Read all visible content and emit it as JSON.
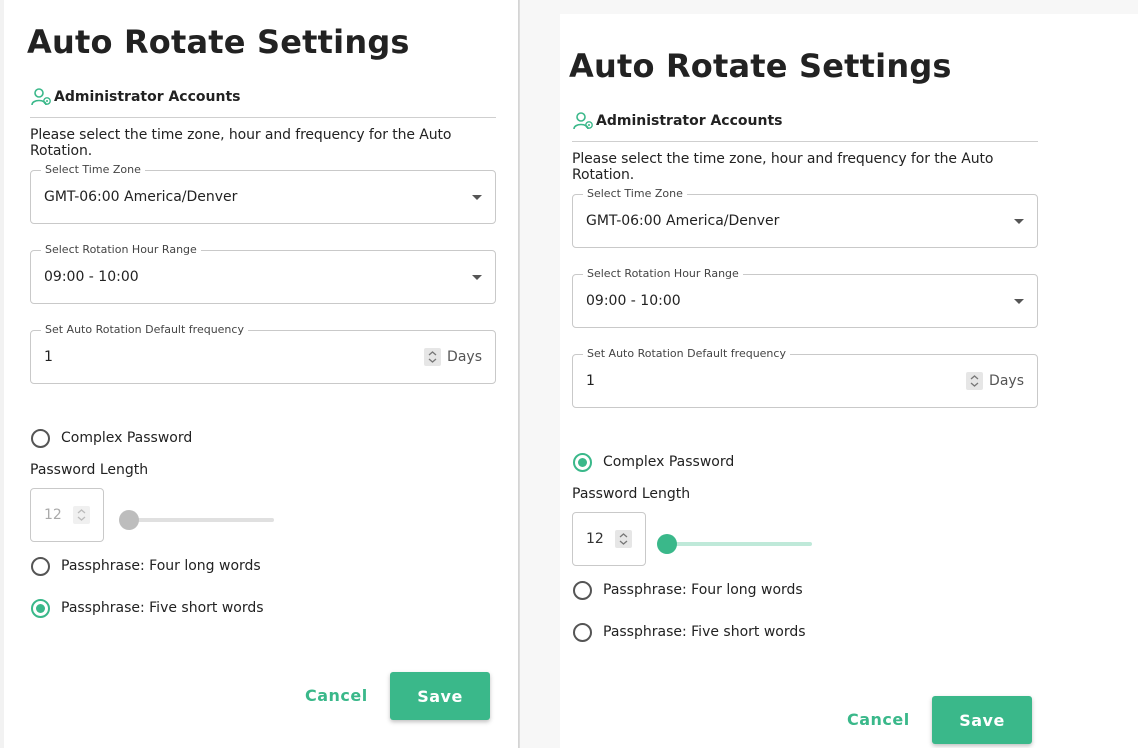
{
  "left_view": {
    "title": "Auto Rotate Settings",
    "section": "Administrator Accounts",
    "description": "Please select the time zone, hour and frequency for the Auto Rotation.",
    "time_zone": {
      "legend": "Select Time Zone",
      "value": "GMT-06:00 America/Denver"
    },
    "hour_range": {
      "legend": "Select Rotation Hour Range",
      "value": "09:00 - 10:00"
    },
    "frequency": {
      "legend": "Set Auto Rotation Default frequency",
      "value": "1",
      "unit": "Days"
    },
    "options": [
      {
        "label": "Complex Password",
        "checked": false
      },
      {
        "label": "Passphrase: Four long words",
        "checked": false
      },
      {
        "label": "Passphrase: Five short words",
        "checked": true
      }
    ],
    "password_length": {
      "label": "Password Length",
      "value": "12",
      "enabled": false
    },
    "cancel_label": "Cancel",
    "save_label": "Save"
  },
  "right_view": {
    "title": "Auto Rotate Settings",
    "section": "Administrator Accounts",
    "description": "Please select the time zone, hour and frequency for the Auto Rotation.",
    "time_zone": {
      "legend": "Select Time Zone",
      "value": "GMT-06:00 America/Denver"
    },
    "hour_range": {
      "legend": "Select Rotation Hour Range",
      "value": "09:00 - 10:00"
    },
    "frequency": {
      "legend": "Set Auto Rotation Default frequency",
      "value": "1",
      "unit": "Days"
    },
    "options": [
      {
        "label": "Complex Password",
        "checked": true
      },
      {
        "label": "Passphrase: Four long words",
        "checked": false
      },
      {
        "label": "Passphrase: Five short words",
        "checked": false
      }
    ],
    "password_length": {
      "label": "Password Length",
      "value": "12",
      "enabled": true
    },
    "cancel_label": "Cancel",
    "save_label": "Save"
  },
  "colors": {
    "accent": "#3ab88a",
    "border": "#c9c9c9",
    "text": "#222222"
  }
}
